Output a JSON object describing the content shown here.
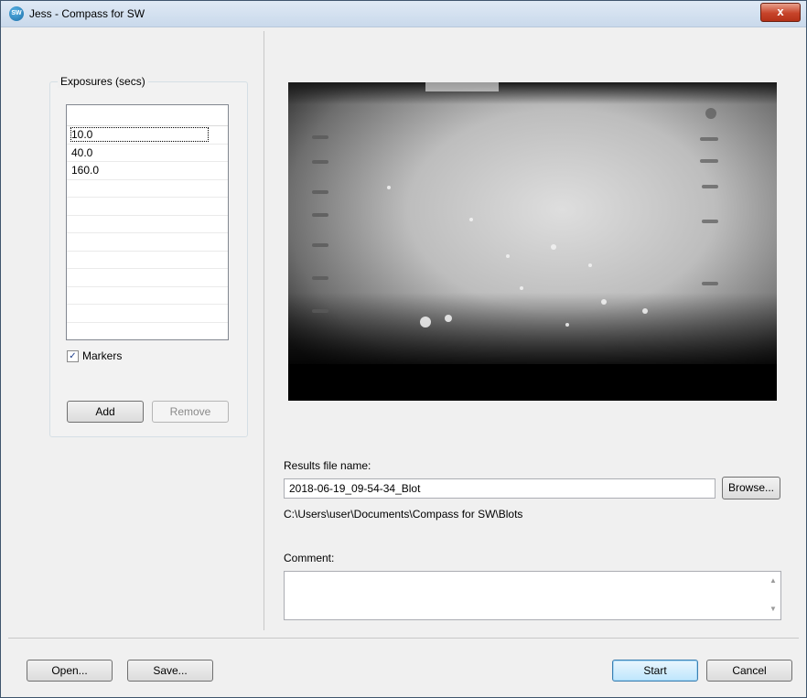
{
  "window": {
    "title": "Jess - Compass for SW",
    "icon_text": "SW",
    "close_label": "x"
  },
  "exposures": {
    "group_label": "Exposures (secs)",
    "items": [
      "10.0",
      "40.0",
      "160.0"
    ],
    "selected": "10.0",
    "markers_label": "Markers",
    "markers_checked": true,
    "add_label": "Add",
    "remove_label": "Remove"
  },
  "preview": {
    "icon": "blot-image-preview"
  },
  "results": {
    "label": "Results file name:",
    "file_name": "2018-06-19_09-54-34_Blot",
    "browse_label": "Browse...",
    "path": "C:\\Users\\user\\Documents\\Compass for SW\\Blots"
  },
  "comment": {
    "label": "Comment:",
    "value": ""
  },
  "footer": {
    "open_label": "Open...",
    "save_label": "Save...",
    "start_label": "Start",
    "cancel_label": "Cancel"
  },
  "colors": {
    "titlebar": "#c9d9eb",
    "close_button": "#c7442a",
    "dialog_bg": "#f0f0f0"
  }
}
